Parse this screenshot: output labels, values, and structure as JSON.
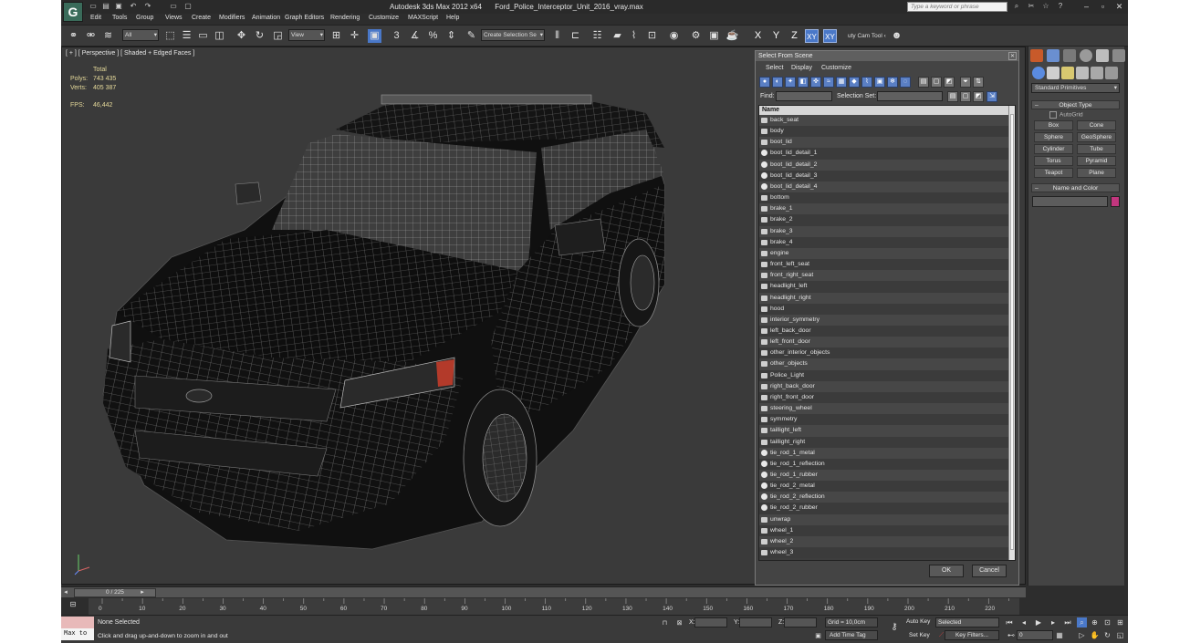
{
  "app": {
    "logo": "G",
    "title_app": "Autodesk 3ds Max  2012 x64",
    "title_file": "Ford_Police_Interceptor_Unit_2016_vray.max",
    "search_placeholder": "Type a keyword or phrase"
  },
  "menu": [
    "Edit",
    "Tools",
    "Group",
    "Views",
    "Create",
    "Modifiers",
    "Animation",
    "Graph Editors",
    "Rendering",
    "Customize",
    "MAXScript",
    "Help"
  ],
  "toolbar": {
    "filter": "All",
    "ref_coord": "View",
    "named_selection": "Create Selection Se",
    "axes": [
      "X",
      "Y",
      "Z",
      "XY",
      "XY"
    ],
    "cam_tool": "uty Cam Tool ‹"
  },
  "viewport": {
    "label": "[ + ] [ Perspective ] [ Shaded + Edged Faces ]",
    "stats": {
      "total_label": "Total",
      "polys_label": "Polys:",
      "polys": "743 435",
      "verts_label": "Verts:",
      "verts": "405 387",
      "fps_label": "FPS:",
      "fps": "46,442"
    }
  },
  "dialog": {
    "title": "Select From Scene",
    "menu": [
      "Select",
      "Display",
      "Customize"
    ],
    "find_label": "Find:",
    "selset_label": "Selection Set:",
    "column_name": "Name",
    "objects": [
      "back_seat",
      "body",
      "boot_lid",
      "boot_lid_detail_1",
      "boot_lid_detail_2",
      "boot_lid_detail_3",
      "boot_lid_detail_4",
      "bottom",
      "brake_1",
      "brake_2",
      "brake_3",
      "brake_4",
      "engine",
      "front_left_seat",
      "front_right_seat",
      "headlight_left",
      "headlight_right",
      "hood",
      "interior_symmetry",
      "left_back_door",
      "left_front_door",
      "other_interior_objects",
      "other_objects",
      "Police_Light",
      "right_back_door",
      "right_front_door",
      "steering_wheel",
      "symmetry",
      "taillight_left",
      "taillight_right",
      "tie_rod_1_metal",
      "tie_rod_1_reflection",
      "tie_rod_1_rubber",
      "tie_rod_2_metal",
      "tie_rod_2_reflection",
      "tie_rod_2_rubber",
      "unwrap",
      "wheel_1",
      "wheel_2",
      "wheel_3"
    ],
    "round_icon_rows": [
      3,
      4,
      5,
      6,
      30,
      31,
      32,
      33,
      34,
      35
    ],
    "ok": "OK",
    "cancel": "Cancel"
  },
  "command_panel": {
    "category": "Standard Primitives",
    "object_type_header": "Object Type",
    "autogrid": "AutoGrid",
    "primitives": [
      "Box",
      "Cone",
      "Sphere",
      "GeoSphere",
      "Cylinder",
      "Tube",
      "Torus",
      "Pyramid",
      "Teapot",
      "Plane"
    ],
    "name_color_header": "Name and Color",
    "color": "#c2367e"
  },
  "timeline": {
    "frame_readout": "0 / 225",
    "ticks": [
      "0",
      "10",
      "20",
      "30",
      "40",
      "50",
      "60",
      "70",
      "80",
      "90",
      "100",
      "110",
      "120",
      "130",
      "140",
      "150",
      "160",
      "170",
      "180",
      "190",
      "200",
      "210",
      "220"
    ]
  },
  "status": {
    "maxscript_label": "Max to",
    "selection": "None Selected",
    "prompt": "Click and drag up-and-down to zoom in and out",
    "x_label": "X:",
    "y_label": "Y:",
    "z_label": "Z:",
    "grid": "Grid = 10,0cm",
    "add_time_tag": "Add Time Tag",
    "auto_key": "Auto Key",
    "set_key": "Set Key",
    "selected": "Selected",
    "key_filters": "Key Filters...",
    "current_frame": "0"
  }
}
